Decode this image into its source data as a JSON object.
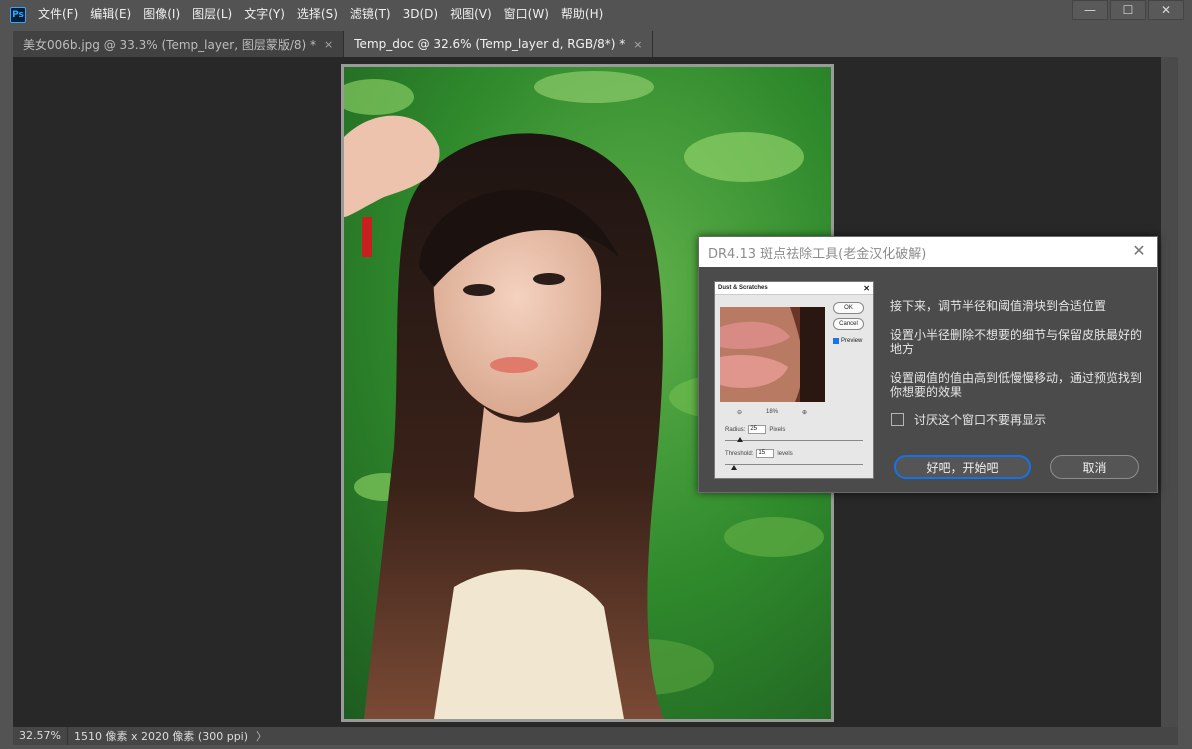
{
  "app": {
    "logo_text": "Ps"
  },
  "menu": [
    "文件(F)",
    "编辑(E)",
    "图像(I)",
    "图层(L)",
    "文字(Y)",
    "选择(S)",
    "滤镜(T)",
    "3D(D)",
    "视图(V)",
    "窗口(W)",
    "帮助(H)"
  ],
  "window_controls": {
    "minimize": "—",
    "maximize": "☐",
    "close": "✕"
  },
  "tabs": [
    {
      "label": "美女006b.jpg @ 33.3% (Temp_layer, 图层蒙版/8) *",
      "close": "×",
      "active": false
    },
    {
      "label": "Temp_doc @ 32.6% (Temp_layer d, RGB/8*) *",
      "close": "×",
      "active": true
    }
  ],
  "status": {
    "zoom": "32.57%",
    "doc_info": "1510 像素 x 2020 像素 (300 ppi)",
    "arrow": "〉"
  },
  "dialog": {
    "title": "DR4.13 斑点祛除工具(老金汉化破解)",
    "close": "✕",
    "paragraphs": [
      "接下来，调节半径和阈值滑块到合适位置",
      "设置小半径删除不想要的细节与保留皮肤最好的地方",
      "设置阈值的值由高到低慢慢移动，通过预览找到你想要的效果"
    ],
    "checkbox_label": "讨厌这个窗口不要再显示",
    "ok_label": "好吧，开始吧",
    "cancel_label": "取消",
    "thumbnail": {
      "title": "Dust & Scratches",
      "close": "✕",
      "ok": "OK",
      "cancel": "Cancel",
      "preview": "Preview",
      "zoom": "18%",
      "radius_label": "Radius:",
      "radius_value": "25",
      "radius_unit": "Pixels",
      "threshold_label": "Threshold:",
      "threshold_value": "15",
      "threshold_unit": "levels"
    }
  },
  "colors": {
    "accent": "#1473e6",
    "panel": "#535353",
    "canvas": "#282828"
  }
}
